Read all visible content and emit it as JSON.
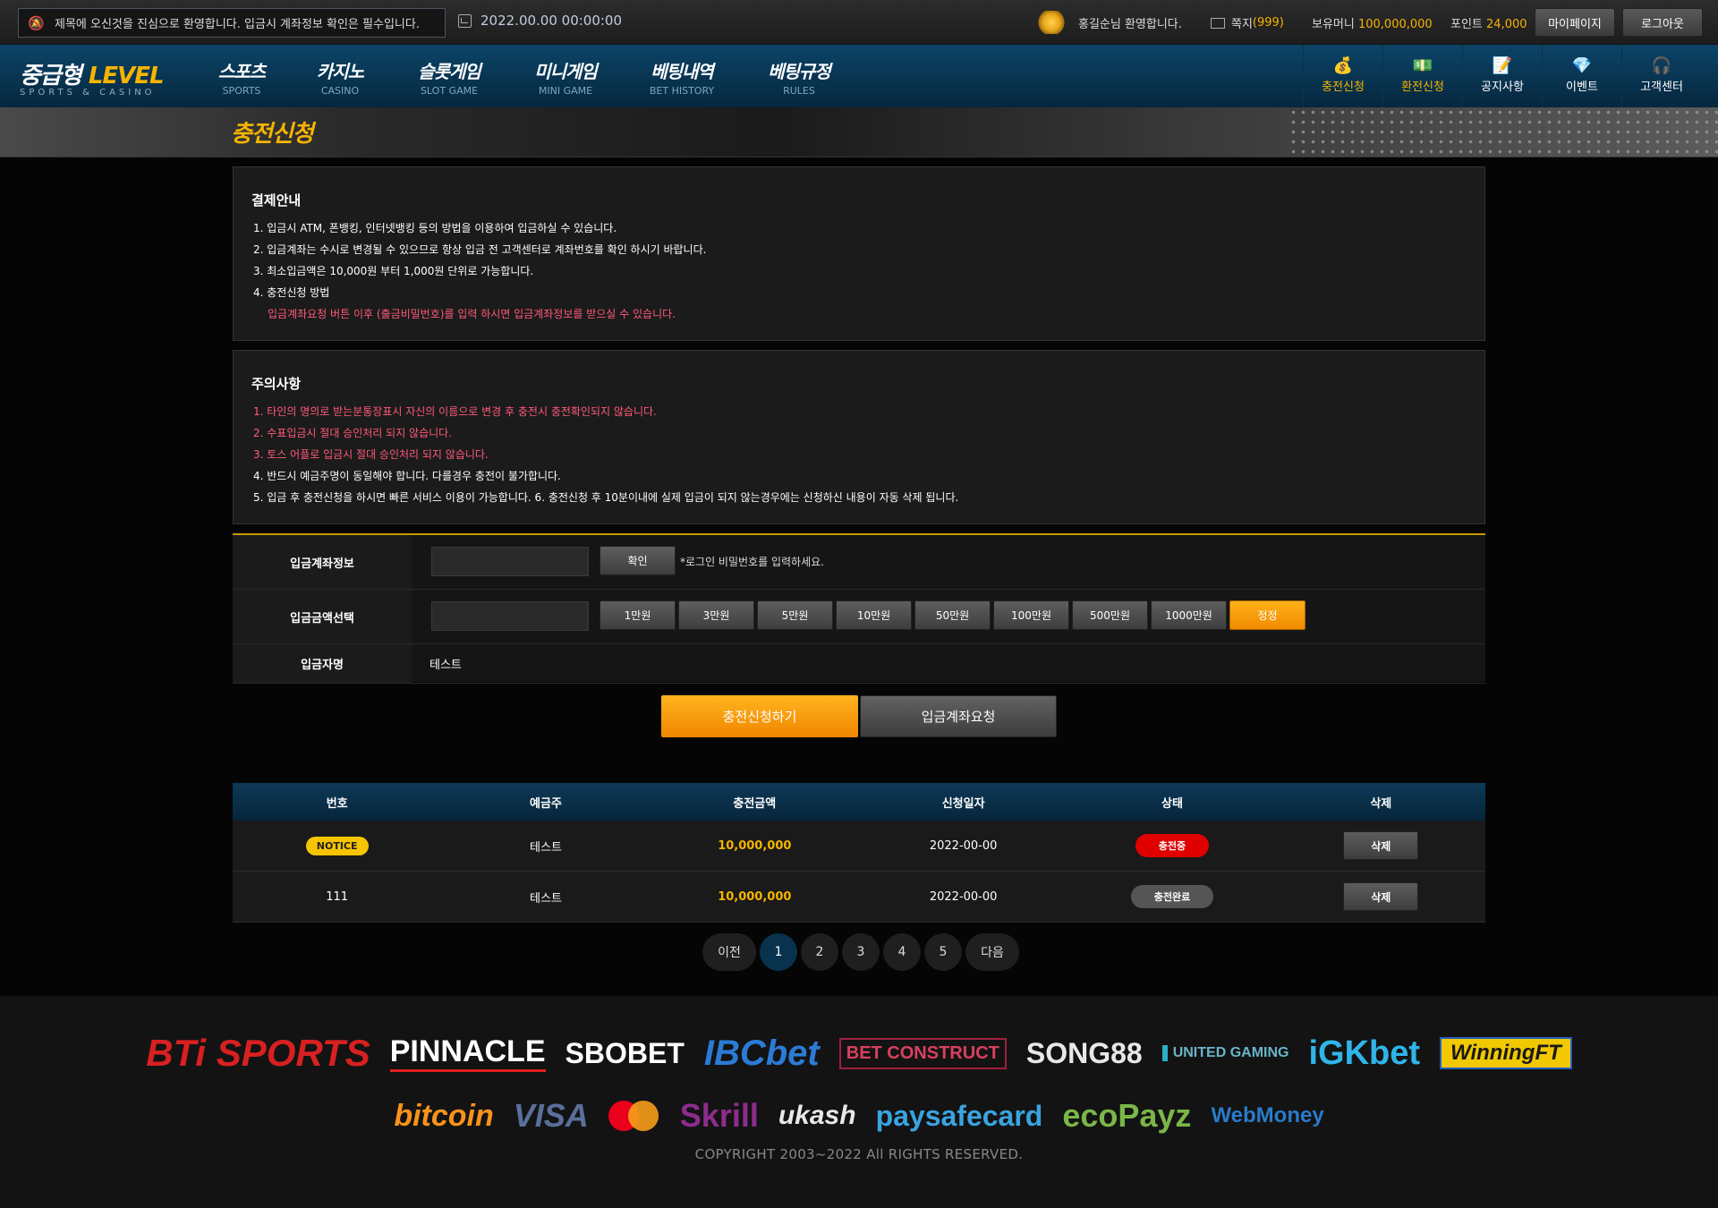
{
  "topbar": {
    "notice": "제목에 오신것을 진심으로 환영합니다. 입금시 계좌정보 확인은 필수입니다.",
    "clock": "2022.00.00 00:00:00",
    "welcome": "홍길순님 환영합니다.",
    "message_label": "쪽지",
    "message_count": "(999)",
    "money_label": "보유머니",
    "money_value": "100,000,000",
    "point_label": "포인트",
    "point_value": "24,000",
    "mypage": "마이페이지",
    "logout": "로그아웃"
  },
  "nav": {
    "logo_main": "중급형",
    "logo_accent": "LEVEL",
    "logo_sub": "SPORTS & CASINO",
    "menu": [
      {
        "ko": "스포츠",
        "en": "SPORTS"
      },
      {
        "ko": "카지노",
        "en": "CASINO"
      },
      {
        "ko": "슬롯게임",
        "en": "SLOT GAME"
      },
      {
        "ko": "미니게임",
        "en": "MINI GAME"
      },
      {
        "ko": "베팅내역",
        "en": "BET HISTORY"
      },
      {
        "ko": "베팅규정",
        "en": "RULES"
      }
    ],
    "quick": [
      {
        "label": "충전신청",
        "icon": "money-bag-icon"
      },
      {
        "label": "환전신청",
        "icon": "cash-icon"
      },
      {
        "label": "공지사항",
        "icon": "notice-icon"
      },
      {
        "label": "이벤트",
        "icon": "diamond-icon"
      },
      {
        "label": "고객센터",
        "icon": "support-icon"
      }
    ]
  },
  "page": {
    "title": "충전신청"
  },
  "payment_info": {
    "title": "결제안내",
    "items": [
      "1. 입금시 ATM, 폰뱅킹, 인터넷뱅킹 등의 방법을 이용하여 입금하실 수 있습니다.",
      "2. 입금계좌는 수시로 변경될 수 있으므로 항상 입금 전 고객센터로 계좌번호를 확인 하시기 바랍니다.",
      "3. 최소입금액은 10,000원 부터 1,000원 단위로 가능합니다.",
      "4. 충전신청 방법",
      "입금계좌요청 버튼 이후 (출금비밀번호)를 입력 하시면 입금계좌정보를 받으실 수 있습니다."
    ]
  },
  "caution": {
    "title": "주의사항",
    "items": [
      "1. 타인의 명의로 받는분통장표시 자신의 이름으로 변경 후 충전시 충전확인되지 않습니다.",
      "2. 수표입금시 절대 승인처리 되지 않습니다.",
      "3. 토스 어플로 입금시 절대 승인처리 되지 않습니다.",
      "4. 반드시 예금주명이 동일해야 합니다. 다를경우 충전이 불가합니다.",
      "5. 입금 후 충전신청을 하시면 빠른 서비스 이용이 가능합니다. 6. 충전신청 후 10분이내에 실제 입금이 되지 않는경우에는 신청하신 내용이 자동 삭제 됩니다."
    ]
  },
  "form": {
    "account_label": "입금계좌정보",
    "confirm": "확인",
    "hint": "*로그인 비밀번호를 입력하세요.",
    "amount_label": "입금금액선택",
    "amounts": [
      "1만원",
      "3만원",
      "5만원",
      "10만원",
      "50만원",
      "100만원",
      "500만원",
      "1000만원"
    ],
    "reset": "정정",
    "depositor_label": "입금자명",
    "depositor_value": "테스트"
  },
  "actions": {
    "submit": "충전신청하기",
    "request": "입금계좌요청"
  },
  "table": {
    "headers": [
      "번호",
      "예금주",
      "충전금액",
      "신청일자",
      "상태",
      "삭제"
    ],
    "rows": [
      {
        "no": "NOTICE",
        "name": "테스트",
        "amount": "10,000,000",
        "date": "2022-00-00",
        "status": "충전중",
        "del": "삭제"
      },
      {
        "no": "111",
        "name": "테스트",
        "amount": "10,000,000",
        "date": "2022-00-00",
        "status": "충전완료",
        "del": "삭제"
      }
    ]
  },
  "pagination": {
    "prev": "이전",
    "pages": [
      "1",
      "2",
      "3",
      "4",
      "5"
    ],
    "next": "다음",
    "current": "1"
  },
  "footer": {
    "partners": [
      "BTi SPORTS",
      "PINNACLE",
      "SBOBET",
      "IBCbet",
      "BET CONSTRUCT",
      "SONG88",
      "UNITED GAMING",
      "iGKbet",
      "WinningFT"
    ],
    "payments": [
      "bitcoin",
      "VISA",
      "mastercard",
      "Skrill",
      "ukash",
      "paysafecard",
      "ecoPayz",
      "WebMoney"
    ],
    "copyright": "COPYRIGHT 2003~2022 All RIGHTS RESERVED."
  }
}
